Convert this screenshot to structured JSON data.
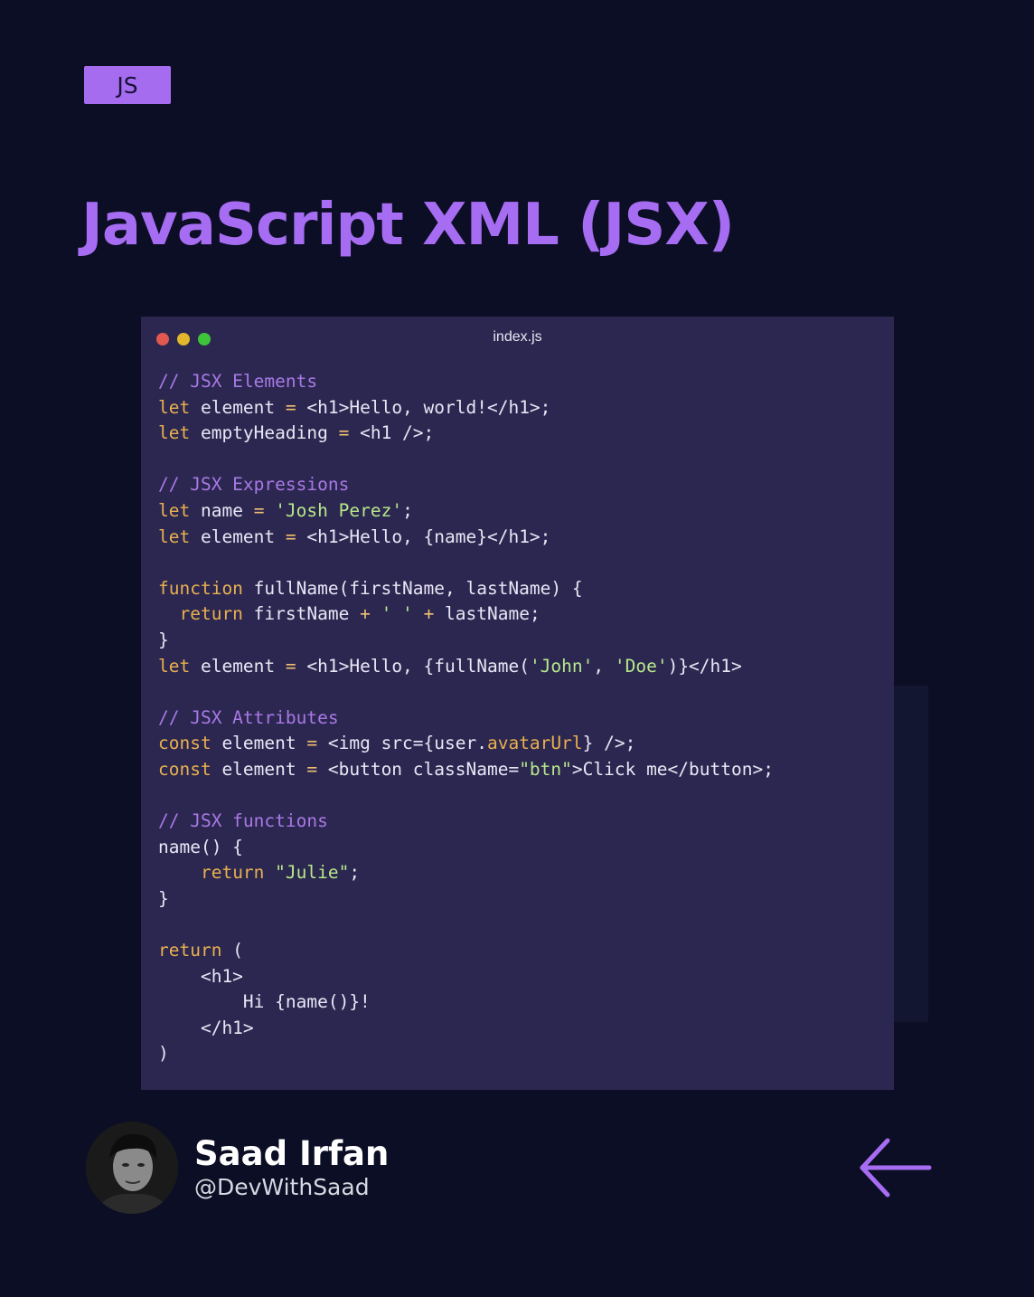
{
  "tag": {
    "label": "JS"
  },
  "title": "JavaScript XML (JSX)",
  "editor": {
    "filename": "index.js",
    "lines": [
      [
        [
          "comment",
          "// JSX Elements"
        ]
      ],
      [
        [
          "keyword",
          "let"
        ],
        [
          "text",
          " element "
        ],
        [
          "op",
          "="
        ],
        [
          "text",
          " <h1>Hello, world!</h1>;"
        ]
      ],
      [
        [
          "keyword",
          "let"
        ],
        [
          "text",
          " emptyHeading "
        ],
        [
          "op",
          "="
        ],
        [
          "text",
          " <h1 />;"
        ]
      ],
      [],
      [
        [
          "comment",
          "// JSX Expressions"
        ]
      ],
      [
        [
          "keyword",
          "let"
        ],
        [
          "text",
          " name "
        ],
        [
          "op",
          "="
        ],
        [
          "text",
          " "
        ],
        [
          "string",
          "'Josh Perez'"
        ],
        [
          "text",
          ";"
        ]
      ],
      [
        [
          "keyword",
          "let"
        ],
        [
          "text",
          " element "
        ],
        [
          "op",
          "="
        ],
        [
          "text",
          " <h1>Hello, {name}</h1>;"
        ]
      ],
      [],
      [
        [
          "keyword",
          "function"
        ],
        [
          "text",
          " fullName(firstName, lastName) {"
        ]
      ],
      [
        [
          "text",
          "  "
        ],
        [
          "keyword",
          "return"
        ],
        [
          "text",
          " firstName "
        ],
        [
          "op",
          "+"
        ],
        [
          "text",
          " "
        ],
        [
          "string",
          "' '"
        ],
        [
          "text",
          " "
        ],
        [
          "op",
          "+"
        ],
        [
          "text",
          " lastName;"
        ]
      ],
      [
        [
          "text",
          "}"
        ]
      ],
      [
        [
          "keyword",
          "let"
        ],
        [
          "text",
          " element "
        ],
        [
          "op",
          "="
        ],
        [
          "text",
          " <h1>Hello, {fullName("
        ],
        [
          "string",
          "'John'"
        ],
        [
          "text",
          ", "
        ],
        [
          "string",
          "'Doe'"
        ],
        [
          "text",
          ")}</h1>"
        ]
      ],
      [],
      [
        [
          "comment",
          "// JSX Attributes"
        ]
      ],
      [
        [
          "keyword",
          "const"
        ],
        [
          "text",
          " element "
        ],
        [
          "op",
          "="
        ],
        [
          "text",
          " <img src={user."
        ],
        [
          "prop",
          "avatarUrl"
        ],
        [
          "text",
          "} />;"
        ]
      ],
      [
        [
          "keyword",
          "const"
        ],
        [
          "text",
          " element "
        ],
        [
          "op",
          "="
        ],
        [
          "text",
          " <button className="
        ],
        [
          "string",
          "\"btn\""
        ],
        [
          "text",
          ">Click me</button>;"
        ]
      ],
      [],
      [
        [
          "comment",
          "// JSX functions"
        ]
      ],
      [
        [
          "text",
          "name() {"
        ]
      ],
      [
        [
          "text",
          "    "
        ],
        [
          "keyword",
          "return"
        ],
        [
          "text",
          " "
        ],
        [
          "string",
          "\"Julie\""
        ],
        [
          "text",
          ";"
        ]
      ],
      [
        [
          "text",
          "}"
        ]
      ],
      [],
      [
        [
          "keyword",
          "return"
        ],
        [
          "text",
          " ("
        ]
      ],
      [
        [
          "text",
          "    <h1>"
        ]
      ],
      [
        [
          "text",
          "        Hi {name()}!"
        ]
      ],
      [
        [
          "text",
          "    </h1>"
        ]
      ],
      [
        [
          "text",
          ")"
        ]
      ]
    ]
  },
  "author": {
    "name": "Saad Irfan",
    "handle": "@DevWithSaad"
  },
  "icons": {
    "back": "arrow-left-icon",
    "window_controls": [
      "close-dot",
      "minimize-dot",
      "maximize-dot"
    ]
  },
  "colors": {
    "background": "#0b0e24",
    "accent": "#a66cf2",
    "editor_bg": "#2c2750",
    "comment": "#a879e6",
    "keyword": "#e8b04f",
    "string": "#b7e88a"
  }
}
